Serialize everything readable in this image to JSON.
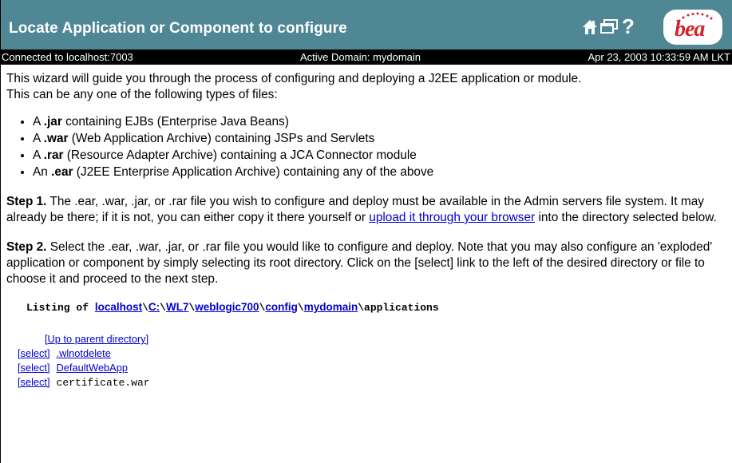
{
  "header": {
    "title": "Locate Application or Component to configure",
    "icons": [
      "home-icon",
      "window-icon",
      "help-icon"
    ],
    "help_glyph": "?",
    "logo_text": "bea"
  },
  "status": {
    "connected": "Connected to localhost:7003",
    "domain": "Active Domain: mydomain",
    "datetime": "Apr 23, 2003 10:33:59 AM LKT"
  },
  "intro": {
    "line1": "This wizard will guide you through the process of configuring and deploying a J2EE application or module.",
    "line2": "This can be any one of the following types of files:"
  },
  "types": [
    {
      "prefix": "A ",
      "ext": ".jar",
      "desc": " containing EJBs (Enterprise Java Beans)"
    },
    {
      "prefix": "A ",
      "ext": ".war",
      "desc": " (Web Application Archive) containing JSPs and Servlets"
    },
    {
      "prefix": "A ",
      "ext": ".rar",
      "desc": " (Resource Adapter Archive) containing a JCA Connector module"
    },
    {
      "prefix": "An ",
      "ext": ".ear",
      "desc": " (J2EE Enterprise Application Archive) containing any of the above"
    }
  ],
  "step1": {
    "label": "Step 1.",
    "text": " The .ear, .war, .jar, or .rar file you wish to configure and deploy must be available in the Admin servers file system. It may already be there; if it is not, you can either copy it there yourself or ",
    "link": "upload it through your browser",
    "text_after": " into the directory selected below."
  },
  "step2": {
    "label": "Step 2.",
    "text": " Select the .ear, .war, .jar, or .rar file you would like to configure and deploy. Note that you may also configure an 'exploded' application or component by simply selecting its root directory. Click on the [select] link to the left of the desired directory or file to choose it and proceed to the next step."
  },
  "listing": {
    "prefix": "Listing of ",
    "sep": "\\",
    "path": [
      "localhost",
      "C:",
      "WL7",
      "weblogic700",
      "config",
      "mydomain"
    ],
    "last": "applications",
    "parent_link": "[Up to parent directory]",
    "select_label": "[select]",
    "entries": [
      {
        "name": ".wlnotdelete",
        "link": true
      },
      {
        "name": "DefaultWebApp",
        "link": true
      },
      {
        "name": "certificate.war",
        "link": false
      }
    ]
  }
}
